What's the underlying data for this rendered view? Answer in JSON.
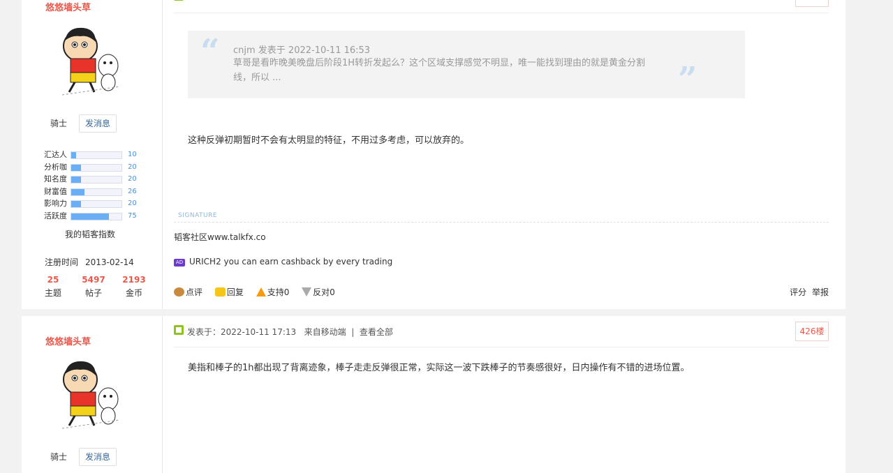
{
  "posts": [
    {
      "user": {
        "name": "悠悠墙头草",
        "rank": "骑士",
        "message_btn": "发消息",
        "stats": [
          {
            "label": "汇达人",
            "value": 10
          },
          {
            "label": "分析咖",
            "value": 20
          },
          {
            "label": "知名度",
            "value": 20
          },
          {
            "label": "财富值",
            "value": 26
          },
          {
            "label": "影响力",
            "value": 20
          },
          {
            "label": "活跃度",
            "value": 75
          }
        ],
        "index_title": "我的韬客指数",
        "reg_label": "注册时间",
        "reg_date": "2013-02-14",
        "counts": [
          {
            "value": "25",
            "label": "主题"
          },
          {
            "value": "5497",
            "label": "帖子"
          },
          {
            "value": "2193",
            "label": "金币"
          }
        ]
      },
      "quote": {
        "meta": "cnjm 发表于 2022-10-11 16:53",
        "body": "草哥是看昨晚美晚盘后阶段1H转折发起么？这个区域支撑感觉不明显，唯一能找到理由的就是黄金分割线，所以 ..."
      },
      "content": "这种反弹初期暂时不会有太明显的特征，不用过多考虑，可以放弃的。",
      "signature_label": "SIGNATURE",
      "signature": "韬客社区www.talkfx.co",
      "ad_badge": "AD",
      "ad_text": "URICH2 you can earn cashback by every trading",
      "actions": {
        "comment": "点评",
        "reply": "回复",
        "support": "支持0",
        "oppose": "反对0",
        "rate": "评分",
        "report": "举报"
      }
    },
    {
      "user": {
        "name": "悠悠墙头草",
        "rank": "骑士",
        "message_btn": "发消息"
      },
      "header": {
        "posted": "发表于：2022-10-11 17:13",
        "source": "来自移动端",
        "view_all": "查看全部",
        "floor": "426楼"
      },
      "content": "美指和棒子的1h都出现了背离迹象，棒子走走反弹很正常，实际这一波下跌棒子的节奏感很好，日内操作有不错的进场位置。"
    }
  ],
  "colors": {
    "accent": "#e8594b",
    "bar_fill": "#6aaef5",
    "link": "#336699"
  }
}
